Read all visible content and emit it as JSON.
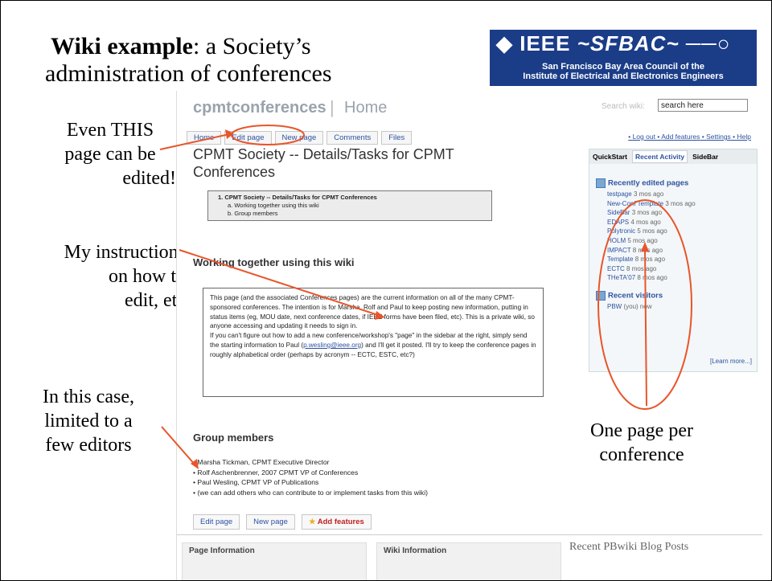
{
  "slide": {
    "title_bold": "Wiki example",
    "title_rest": ": a Society’s",
    "title_line2": "administration of conferences",
    "annotations": {
      "edit_page": [
        "Even THIS",
        "page can be",
        "edited!"
      ],
      "instructions": [
        "My instructions",
        "on how to",
        "edit, etc"
      ],
      "editors": [
        "In this case,",
        "limited to a",
        "few editors"
      ],
      "conference": [
        "One page per",
        "conference"
      ]
    },
    "logo": {
      "text": "IEEE",
      "region": "SFBAC",
      "sub_line1": "San Francisco Bay Area Council of the",
      "sub_line2": "Institute of Electrical and Electronics Engineers"
    },
    "annotation_color": "#e8552a"
  },
  "wiki": {
    "name": "cpmtconferences",
    "separator": "|",
    "page": "Home",
    "search_label": "Search wiki:",
    "search_value": "search here",
    "tabs": [
      "Home",
      "Edit page",
      "New page",
      "Comments",
      "Files"
    ],
    "toplinks": [
      "Log out",
      "Add features",
      "Settings",
      "Help"
    ],
    "page_title": "CPMT Society -- Details/Tasks for CPMT Conferences",
    "toc": {
      "heading": "1.  CPMT Society -- Details/Tasks for CPMT Conferences",
      "items": [
        "a.  Working together using this wiki",
        "b.  Group members"
      ]
    },
    "section1": "Working together using this wiki",
    "para1": "This page (and the associated Conferences pages) are the current information on all of the many CPMT-sponsored conferences. The intention is for Marsha, Rolf and Paul to keep posting new information, putting in status items (eg, MOU date, next conference dates, if IEEE forms have been filed, etc). This is a private wiki, so anyone accessing and updating it needs to sign in.",
    "para2_a": "If you can't figure out how to add a new conference/workshop's \"page\" in the sidebar at the right, simply send the starting information to Paul (",
    "para2_email": "p.wesling@ieee.org",
    "para2_b": ") and I'll get it posted. I'll try to keep the conference pages in roughly alphabetical order (perhaps by acronym -- ECTC, ESTC, etc?)",
    "section2": "Group members",
    "members": [
      "Marsha Tickman, CPMT Executive Director",
      "Rolf Aschenbrenner, 2007 CPMT VP of Conferences",
      "Paul Wesling, CPMT VP of Publications",
      "(we can add others who can contribute to or implement tasks from this wiki)"
    ],
    "bottom_buttons": [
      "Edit page",
      "New page",
      "Add features"
    ],
    "footer": [
      "Page Information",
      "Wiki Information",
      "Recent PBwiki Blog Posts"
    ],
    "sidebar": {
      "tabs": [
        "QuickStart",
        "Recent Activity",
        "SideBar"
      ],
      "recent_heading": "Recently edited pages",
      "recent_pages": [
        {
          "name": "testpage",
          "age": "3 mos ago"
        },
        {
          "name": "New-Conf Template",
          "age": "3 mos ago"
        },
        {
          "name": "SideBar",
          "age": "3 mos ago"
        },
        {
          "name": "EDAPS",
          "age": "4 mos ago"
        },
        {
          "name": "Polytronic",
          "age": "5 mos ago"
        },
        {
          "name": "HOLM",
          "age": "5 mos ago"
        },
        {
          "name": "IMPACT",
          "age": "8 mos ago"
        },
        {
          "name": "Template",
          "age": "8 mos ago"
        },
        {
          "name": "ECTC",
          "age": "8 mos ago"
        },
        {
          "name": "THeTA'07",
          "age": "8 mos ago"
        }
      ],
      "visitors_heading": "Recent visitors",
      "visitor": "PBW",
      "visitor_note": "(you) now",
      "learn_more": "[Learn more...]"
    }
  }
}
